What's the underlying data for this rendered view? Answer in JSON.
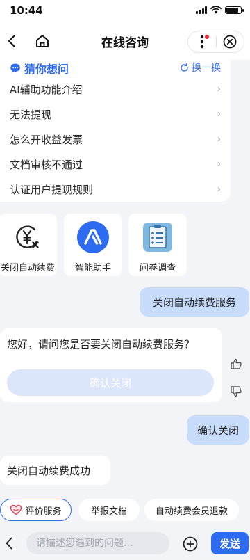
{
  "status_bar": {
    "time": "10:44",
    "icons": [
      "signal-icon",
      "wifi-icon",
      "battery-icon"
    ]
  },
  "nav": {
    "title": "在线咨询",
    "icons": [
      "back-icon",
      "home-icon",
      "more-icon",
      "close-icon"
    ]
  },
  "guess": {
    "title": "猜你想问",
    "refresh_label": "换一换",
    "questions": [
      "AI辅助功能介绍",
      "无法提现",
      "怎么开收益发票",
      "文档审核不通过",
      "认证用户提现规则"
    ]
  },
  "tiles": [
    {
      "label": "关闭自动续费",
      "icon": "cancel-renewal-icon"
    },
    {
      "label": "智能助手",
      "icon": "assistant-icon"
    },
    {
      "label": "问卷调查",
      "icon": "survey-icon"
    }
  ],
  "chat": {
    "user_msg_1": "关闭自动续费服务",
    "bot_msg_1": "您好，请问您是否要关闭自动续费服务？",
    "confirm_button": "确认关闭",
    "user_msg_2": "确认关闭",
    "bot_msg_2": "关闭自动续费成功"
  },
  "chips": [
    "评价服务",
    "举报文档",
    "自动续费会员退款"
  ],
  "input": {
    "placeholder": "请描述您遇到的问题...",
    "value": "",
    "send_label": "发送"
  },
  "colors": {
    "accent": "#2d6bf0",
    "user_bubble": "#c7dcfb",
    "background": "#f3f4f8",
    "confirm_disabled": "#dce6fb"
  }
}
